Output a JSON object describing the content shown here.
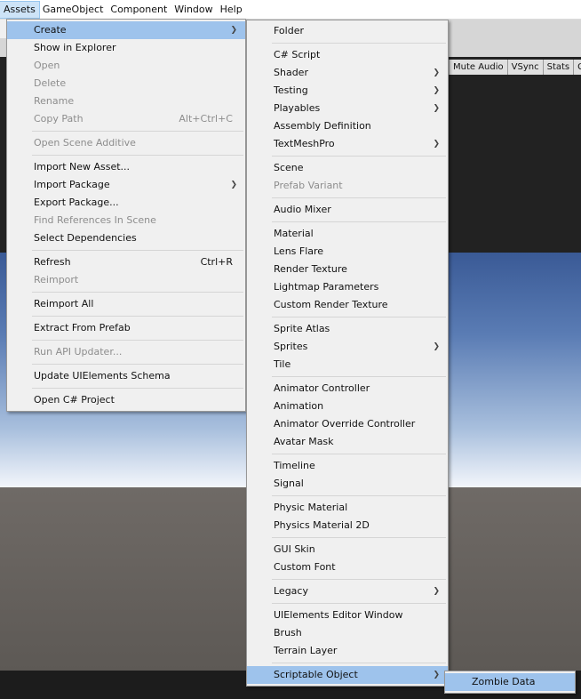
{
  "menubar": [
    "Assets",
    "GameObject",
    "Component",
    "Window",
    "Help"
  ],
  "game_toolbar": [
    "Mute Audio",
    "VSync",
    "Stats",
    "Gi"
  ],
  "assets_menu": [
    {
      "label": "Create",
      "submenu": true,
      "highlight": true
    },
    {
      "label": "Show in Explorer"
    },
    {
      "label": "Open",
      "disabled": true
    },
    {
      "label": "Delete",
      "disabled": true
    },
    {
      "label": "Rename",
      "disabled": true
    },
    {
      "label": "Copy Path",
      "shortcut": "Alt+Ctrl+C",
      "disabled": true
    },
    {
      "separator": true
    },
    {
      "label": "Open Scene Additive",
      "disabled": true
    },
    {
      "separator": true
    },
    {
      "label": "Import New Asset..."
    },
    {
      "label": "Import Package",
      "submenu": true
    },
    {
      "label": "Export Package..."
    },
    {
      "label": "Find References In Scene",
      "disabled": true
    },
    {
      "label": "Select Dependencies"
    },
    {
      "separator": true
    },
    {
      "label": "Refresh",
      "shortcut": "Ctrl+R"
    },
    {
      "label": "Reimport",
      "disabled": true
    },
    {
      "separator": true
    },
    {
      "label": "Reimport All"
    },
    {
      "separator": true
    },
    {
      "label": "Extract From Prefab"
    },
    {
      "separator": true
    },
    {
      "label": "Run API Updater...",
      "disabled": true
    },
    {
      "separator": true
    },
    {
      "label": "Update UIElements Schema"
    },
    {
      "separator": true
    },
    {
      "label": "Open C# Project"
    }
  ],
  "create_menu": [
    {
      "label": "Folder"
    },
    {
      "separator": true
    },
    {
      "label": "C# Script"
    },
    {
      "label": "Shader",
      "submenu": true
    },
    {
      "label": "Testing",
      "submenu": true
    },
    {
      "label": "Playables",
      "submenu": true
    },
    {
      "label": "Assembly Definition"
    },
    {
      "label": "TextMeshPro",
      "submenu": true
    },
    {
      "separator": true
    },
    {
      "label": "Scene"
    },
    {
      "label": "Prefab Variant",
      "disabled": true
    },
    {
      "separator": true
    },
    {
      "label": "Audio Mixer"
    },
    {
      "separator": true
    },
    {
      "label": "Material"
    },
    {
      "label": "Lens Flare"
    },
    {
      "label": "Render Texture"
    },
    {
      "label": "Lightmap Parameters"
    },
    {
      "label": "Custom Render Texture"
    },
    {
      "separator": true
    },
    {
      "label": "Sprite Atlas"
    },
    {
      "label": "Sprites",
      "submenu": true
    },
    {
      "label": "Tile"
    },
    {
      "separator": true
    },
    {
      "label": "Animator Controller"
    },
    {
      "label": "Animation"
    },
    {
      "label": "Animator Override Controller"
    },
    {
      "label": "Avatar Mask"
    },
    {
      "separator": true
    },
    {
      "label": "Timeline"
    },
    {
      "label": "Signal"
    },
    {
      "separator": true
    },
    {
      "label": "Physic Material"
    },
    {
      "label": "Physics Material 2D"
    },
    {
      "separator": true
    },
    {
      "label": "GUI Skin"
    },
    {
      "label": "Custom Font"
    },
    {
      "separator": true
    },
    {
      "label": "Legacy",
      "submenu": true
    },
    {
      "separator": true
    },
    {
      "label": "UIElements Editor Window"
    },
    {
      "label": "Brush"
    },
    {
      "label": "Terrain Layer"
    },
    {
      "separator": true
    },
    {
      "label": "Scriptable Object",
      "submenu": true,
      "highlight": true
    }
  ],
  "scriptable_menu": [
    {
      "label": "Zombie Data",
      "highlight": true
    }
  ],
  "icons": {
    "submenu": "chevron-right-icon"
  },
  "colors": {
    "highlight": "#9ec3ec",
    "menu_bg": "#f0f0f0",
    "disabled": "#8d8d8d"
  }
}
